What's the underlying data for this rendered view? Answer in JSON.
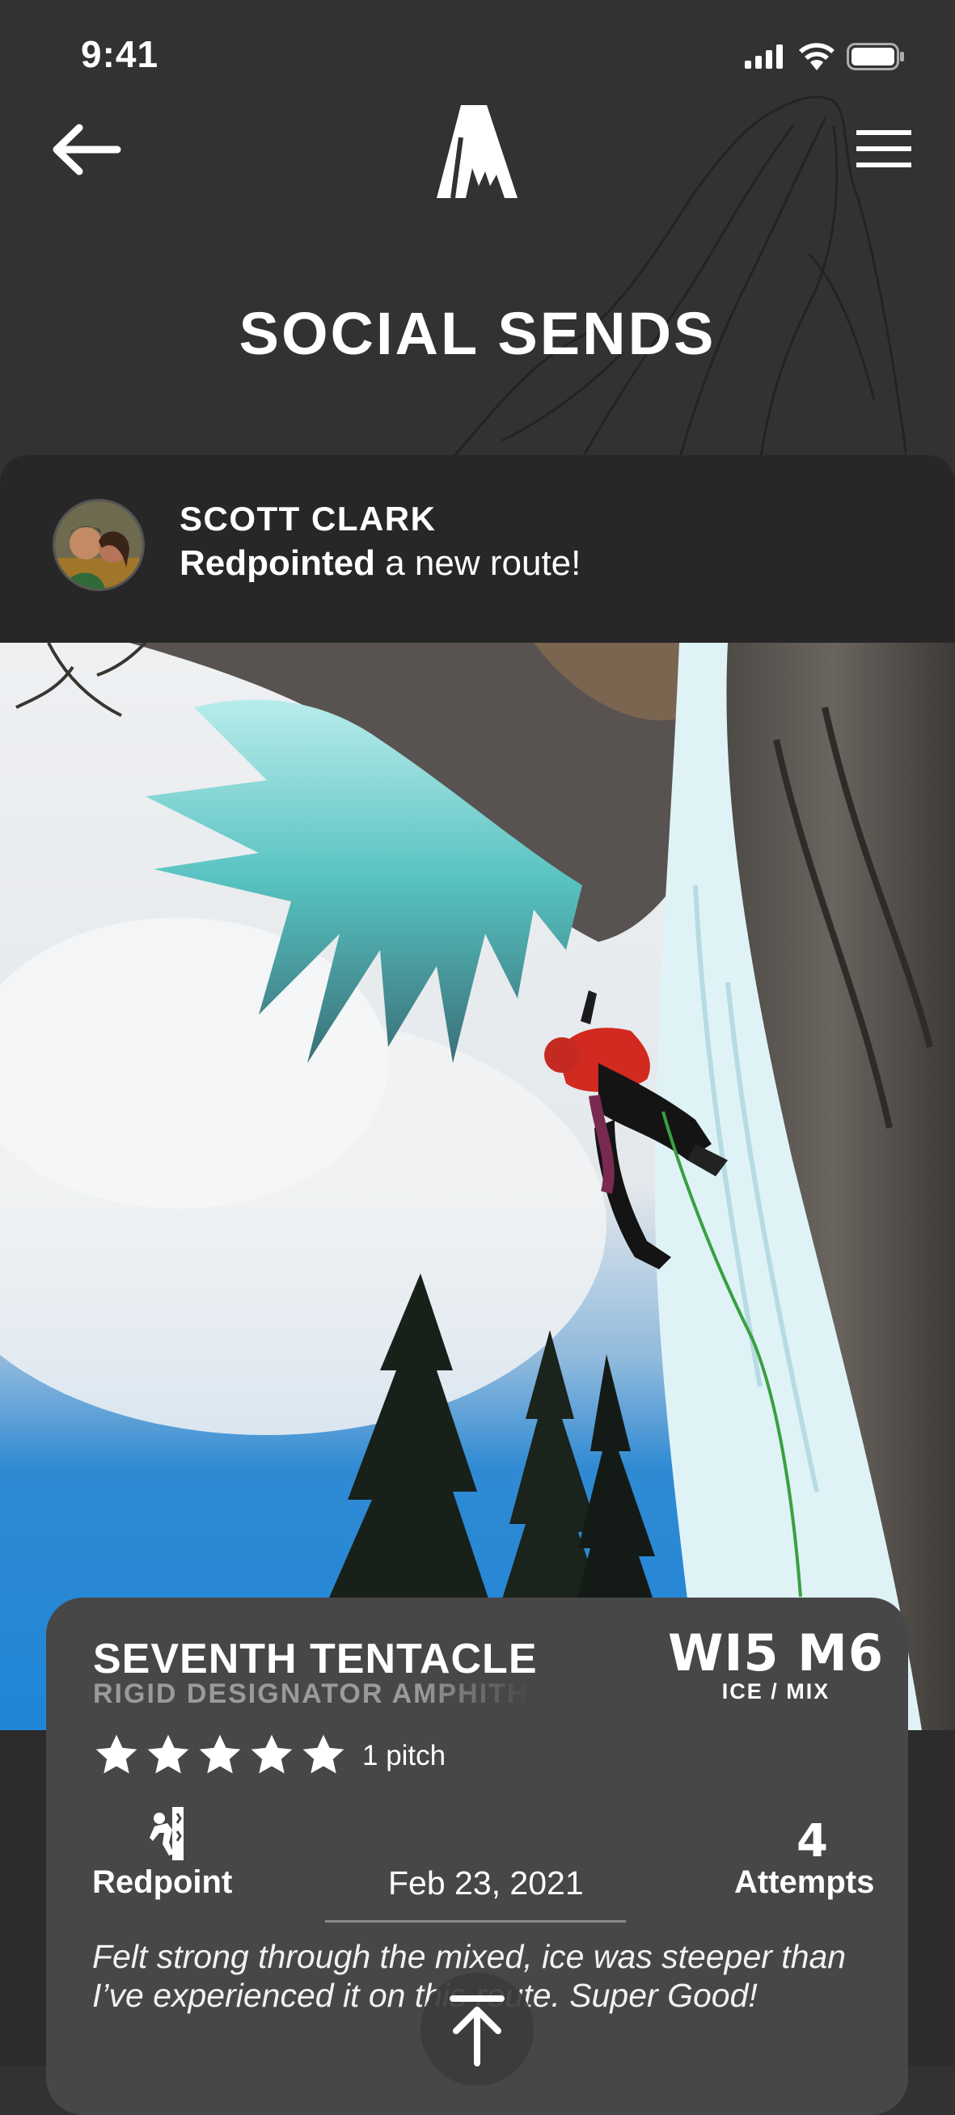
{
  "status_bar": {
    "time": "9:41"
  },
  "header": {
    "title": "SOCIAL SENDS"
  },
  "post": {
    "user_name": "SCOTT CLARK",
    "action_bold": "Redpointed",
    "action_rest": " a new route!"
  },
  "route": {
    "name": "SEVENTH TENTACLE",
    "area": "RIGID DESIGNATOR AMPHITHEATER",
    "grade": "WI5 M6",
    "grade_type": "ICE / MIX",
    "rating_stars": 5,
    "pitches": "1 pitch"
  },
  "send": {
    "style": "Redpoint",
    "date": "Feb 23, 2021",
    "attempts": "4",
    "attempts_label": "Attempts",
    "comment": "Felt strong through the mixed, ice was steeper than I’ve experienced it on this route. Super Good!"
  },
  "icons": {
    "back": "arrow-left-icon",
    "menu": "hamburger-menu-icon",
    "logo": "mountain-logo-icon",
    "scroll_top": "arrow-up-icon",
    "climb": "climber-icon"
  },
  "colors": {
    "background": "#323232",
    "card": "#474747",
    "header_card": "#272727"
  }
}
